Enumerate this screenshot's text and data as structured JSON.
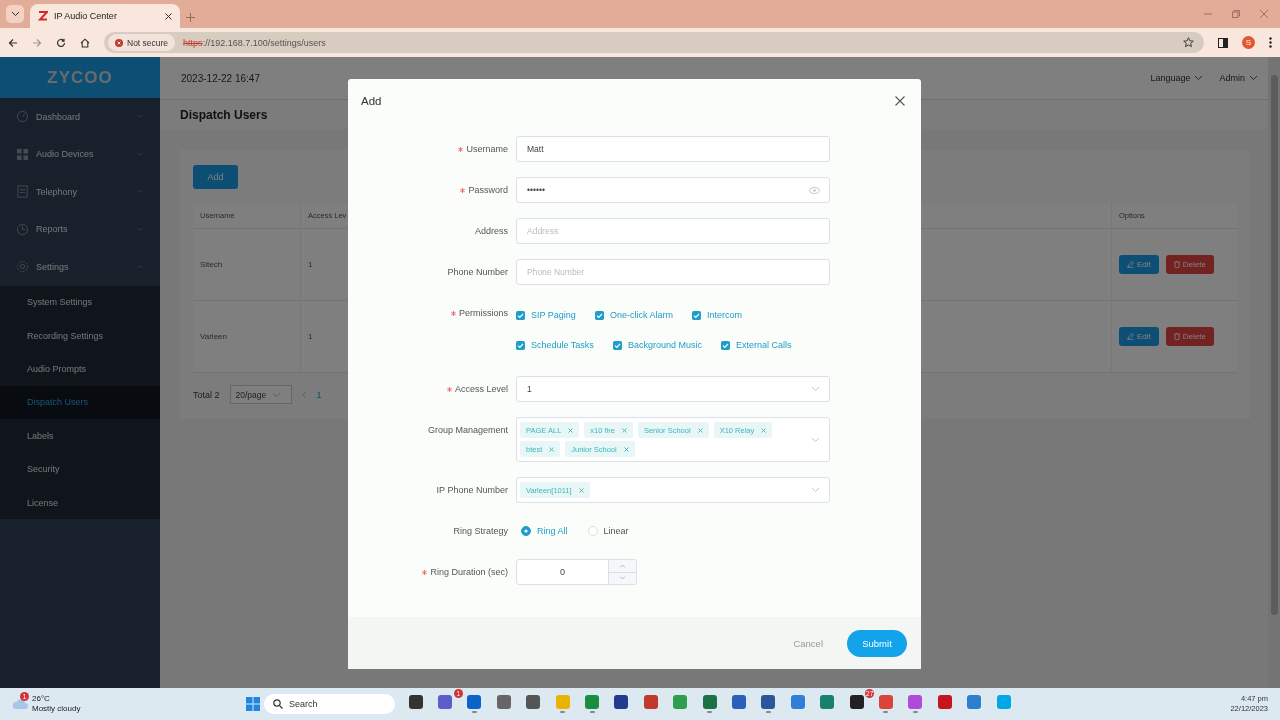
{
  "browser": {
    "tab_title": "IP Audio Center",
    "security": "Not secure",
    "url_scheme": "https",
    "url_rest": "://192.168.7.100/settings/users",
    "profile": "S"
  },
  "header": {
    "logo": "ZYCOO",
    "datetime": "2023-12-22 16:47",
    "menus": [
      "Language",
      "Admin"
    ]
  },
  "sidebar": {
    "items": [
      {
        "label": "Dashboard",
        "expanded": false
      },
      {
        "label": "Audio Devices",
        "expanded": false
      },
      {
        "label": "Telephony",
        "expanded": false
      },
      {
        "label": "Reports",
        "expanded": false
      },
      {
        "label": "Settings",
        "expanded": true,
        "children": [
          {
            "label": "System Settings",
            "selected": false
          },
          {
            "label": "Recording Settings",
            "selected": false
          },
          {
            "label": "Audio Prompts",
            "selected": false
          },
          {
            "label": "Dispatch Users",
            "selected": true
          },
          {
            "label": "Labels",
            "selected": false
          },
          {
            "label": "Security",
            "selected": false
          },
          {
            "label": "License",
            "selected": false
          }
        ]
      }
    ]
  },
  "page": {
    "title": "Dispatch Users",
    "add_button": "Add",
    "columns": [
      "Username",
      "Access Lev",
      "Options"
    ],
    "rows": [
      {
        "username": "Sitech",
        "access_level": "1",
        "actions": [
          "Edit",
          "Delete"
        ]
      },
      {
        "username": "Varleen",
        "access_level": "1",
        "actions": [
          "Edit",
          "Delete"
        ]
      }
    ],
    "pagination": {
      "total": "Total 2",
      "page_size": "20/page",
      "page": "1"
    }
  },
  "modal": {
    "title": "Add",
    "fields": [
      {
        "kind": "text",
        "label": "Username",
        "required": true,
        "value": "Matt"
      },
      {
        "kind": "password",
        "label": "Password",
        "required": true,
        "value": "••••••"
      },
      {
        "kind": "text",
        "label": "Address",
        "required": false,
        "placeholder": "Address"
      },
      {
        "kind": "text",
        "label": "Phone Number",
        "required": false,
        "placeholder": "Phone Number"
      },
      {
        "kind": "checkboxes",
        "label": "Permissions",
        "required": true,
        "options": [
          {
            "label": "SIP Paging",
            "checked": true
          },
          {
            "label": "One-click Alarm",
            "checked": true
          },
          {
            "label": "Intercom",
            "checked": true
          },
          {
            "label": "Schedule Tasks",
            "checked": true
          },
          {
            "label": "Background Music",
            "checked": true
          },
          {
            "label": "External Calls",
            "checked": true
          }
        ]
      },
      {
        "kind": "select",
        "label": "Access Level",
        "required": true,
        "value": "1"
      },
      {
        "kind": "tags",
        "label": "Group Management",
        "required": false,
        "tags": [
          "PAGE ALL",
          "x10 fire",
          "Senior School",
          "X10 Relay",
          "btest",
          "Junior School"
        ]
      },
      {
        "kind": "tags",
        "label": "IP Phone Number",
        "required": false,
        "tags": [
          "Varleen[1011]"
        ]
      },
      {
        "kind": "radio",
        "label": "Ring Strategy",
        "required": false,
        "options": [
          {
            "label": "Ring All",
            "selected": true
          },
          {
            "label": "Linear",
            "selected": false
          }
        ]
      },
      {
        "kind": "number",
        "label": "Ring Duration (sec)",
        "required": true,
        "value": "0"
      }
    ],
    "buttons": [
      "Cancel",
      "Submit"
    ]
  },
  "taskbar": {
    "weather_badge": "1",
    "temperature": "26°C",
    "weather": "Mostly cloudy",
    "search": "Search",
    "time": "4:47 pm",
    "date": "22/12/2023",
    "apps": [
      {
        "running": false
      },
      {
        "running": false,
        "badge": "1"
      },
      {
        "running": true
      },
      {
        "running": false
      },
      {
        "running": false
      },
      {
        "running": true
      },
      {
        "running": true
      },
      {
        "running": false
      },
      {
        "running": false
      },
      {
        "running": false
      },
      {
        "running": true
      },
      {
        "running": false
      },
      {
        "running": true
      },
      {
        "running": false
      },
      {
        "running": false
      },
      {
        "running": false,
        "badge": "27"
      },
      {
        "running": true
      },
      {
        "running": true
      },
      {
        "running": false
      },
      {
        "running": false
      },
      {
        "running": false
      }
    ]
  }
}
